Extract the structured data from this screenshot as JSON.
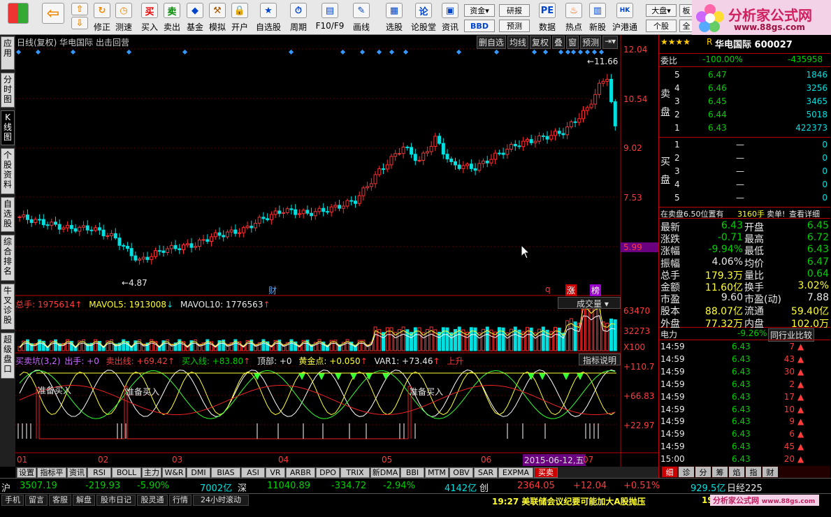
{
  "toolbar": {
    "buttons": [
      "买入",
      "卖出",
      "基金",
      "模拟",
      "开户",
      "自选股",
      "周期",
      "F10/F9",
      "画线",
      "选股",
      "论股堂",
      "资讯",
      "数据",
      "热点",
      "新股",
      "沪港通"
    ],
    "left_buttons": [
      "修正",
      "测速"
    ],
    "small": {
      "zijin": "资金",
      "bbd": "BBD",
      "yanbao": "研报",
      "yuce": "预测",
      "dapan": "大盘",
      "gegu": "个股",
      "ban": "板",
      "quan": "全"
    }
  },
  "logo": {
    "text": "分析家公式网",
    "url": "www.88gs.com"
  },
  "vtabs": [
    "应用",
    "分时图",
    "K线图",
    "个股资料",
    "自选股",
    "综合排名",
    "牛叉诊股",
    "超级盘口"
  ],
  "chart": {
    "header": "日线(复权)  华电国际 出击回营",
    "buttons": [
      "删自选",
      "均线",
      "复权",
      "叠",
      "窗",
      "预测"
    ],
    "price_axis": [
      "12.04",
      "10.54",
      "9.02",
      "7.53",
      "5.99"
    ],
    "high_label": "11.66",
    "low_label": "4.87",
    "markers": {
      "cai": "财",
      "q": "q",
      "zhang": "涨",
      "bang": "榜"
    },
    "vol_header": {
      "total": "总手: 1975614",
      "mavol5": "MAVOL5: 1913008",
      "mavol10": "MAVOL10: 1776563"
    },
    "vol_select": "成交量",
    "vol_axis": [
      "63470",
      "32273",
      "X100"
    ],
    "ind_header": {
      "name": "买卖坑(3,2)",
      "chushou": "出手: +0",
      "maichu": "卖出线: +69.42",
      "mairu": "买入线: +83.80",
      "dingbu": "顶部: +0",
      "huangjin": "黄金点: +0.050",
      "var1": "VAR1: +73.46",
      "up": "上升"
    },
    "ind_button": "指标说明",
    "ind_axis": [
      "+110.7",
      "+66.83",
      "+22.97"
    ],
    "ready_label": "准备买入",
    "months": [
      "01",
      "02",
      "03",
      "04",
      "05",
      "06",
      "07"
    ],
    "date_hl": "2015-06-12,五"
  },
  "bottomtabs": [
    "设置",
    "指标平台",
    "资讯",
    "RSI",
    "BOLL",
    "主力",
    "W&R",
    "DMI",
    "BIAS",
    "ASI",
    "VR",
    "ARBR",
    "DPO",
    "TRIX",
    "新DMA",
    "BBI",
    "MTM",
    "OBV",
    "SAR",
    "EXPMA",
    "买卖坑"
  ],
  "right": {
    "stars": "★★★★",
    "r": "R",
    "name": "华电国际 600027",
    "weibi": {
      "label": "委比",
      "pct": "-100.00%",
      "val": "-435958"
    },
    "sell_label": "卖盘",
    "buy_label": "买盘",
    "sell": [
      {
        "n": "5",
        "p": "6.47",
        "v": "1846"
      },
      {
        "n": "4",
        "p": "6.46",
        "v": "3256"
      },
      {
        "n": "3",
        "p": "6.45",
        "v": "3465"
      },
      {
        "n": "2",
        "p": "6.44",
        "v": "5018"
      },
      {
        "n": "1",
        "p": "6.43",
        "v": "422373"
      }
    ],
    "buy": [
      {
        "n": "1",
        "p": "—",
        "v": "0"
      },
      {
        "n": "2",
        "p": "—",
        "v": "0"
      },
      {
        "n": "3",
        "p": "—",
        "v": "0"
      },
      {
        "n": "4",
        "p": "—",
        "v": "0"
      },
      {
        "n": "5",
        "p": "—",
        "v": "0"
      }
    ],
    "note": {
      "a": "在卖盘6.50位置有",
      "b": "3160手",
      "c": "卖单!",
      "d": "查看详细"
    },
    "stats": [
      {
        "l1": "最新",
        "v1": "6.43",
        "l2": "开盘",
        "v2": "6.45"
      },
      {
        "l1": "涨跌",
        "v1": "-0.71",
        "l2": "最高",
        "v2": "6.72"
      },
      {
        "l1": "涨幅",
        "v1": "-9.94%",
        "l2": "最低",
        "v2": "6.43"
      },
      {
        "l1": "振幅",
        "v1": "4.06%",
        "l2": "均价",
        "v2": "6.47"
      },
      {
        "l1": "总手",
        "v1": "179.3万",
        "l2": "量比",
        "v2": "0.64"
      },
      {
        "l1": "金额",
        "v1": "11.60亿",
        "l2": "换手",
        "v2": "3.02%"
      },
      {
        "l1": "市盈",
        "v1": "9.60",
        "l2": "市盈(动)",
        "v2": "7.88"
      },
      {
        "l1": "股本",
        "v1": "88.07亿",
        "l2": "流通",
        "v2": "59.40亿"
      },
      {
        "l1": "外盘",
        "v1": "77.32万",
        "l2": "内盘",
        "v2": "102.0万"
      }
    ],
    "sector": {
      "name": "电力",
      "pct": "-9.26%",
      "btn": "同行业比较"
    },
    "ticks": [
      {
        "t": "14:59",
        "p": "6.43",
        "v": "7"
      },
      {
        "t": "14:59",
        "p": "6.43",
        "v": "43"
      },
      {
        "t": "14:59",
        "p": "6.43",
        "v": "30"
      },
      {
        "t": "14:59",
        "p": "6.43",
        "v": "2"
      },
      {
        "t": "14:59",
        "p": "6.43",
        "v": "17"
      },
      {
        "t": "14:59",
        "p": "6.43",
        "v": "10"
      },
      {
        "t": "14:59",
        "p": "6.43",
        "v": "9"
      },
      {
        "t": "14:59",
        "p": "6.43",
        "v": "6"
      },
      {
        "t": "14:59",
        "p": "6.43",
        "v": "45"
      },
      {
        "t": "15:00",
        "p": "6.43",
        "v": "20"
      }
    ],
    "tabs": [
      "细",
      "诊",
      "分",
      "筹",
      "焰",
      "指",
      "财"
    ]
  },
  "status": {
    "sh": {
      "l": "沪",
      "v": "3507.19",
      "c": "-219.93",
      "p": "-5.90%",
      "a": "7002亿"
    },
    "sz": {
      "l": "深",
      "v": "11040.89",
      "c": "-334.72",
      "p": "-2.94%",
      "a": "4142亿"
    },
    "cy": {
      "l": "创",
      "v": "2364.05",
      "c": "+12.04",
      "p": "+0.51%",
      "a": "929.5亿"
    },
    "nk": "日经225"
  },
  "foot": {
    "buttons": [
      "手机",
      "留言",
      "客服",
      "解盘",
      "股市日记",
      "股灵通",
      "行情",
      "24小时滚动"
    ],
    "news": "19:27 美联储会议纪要可能加大A股抛压",
    "news2": "19:"
  }
}
